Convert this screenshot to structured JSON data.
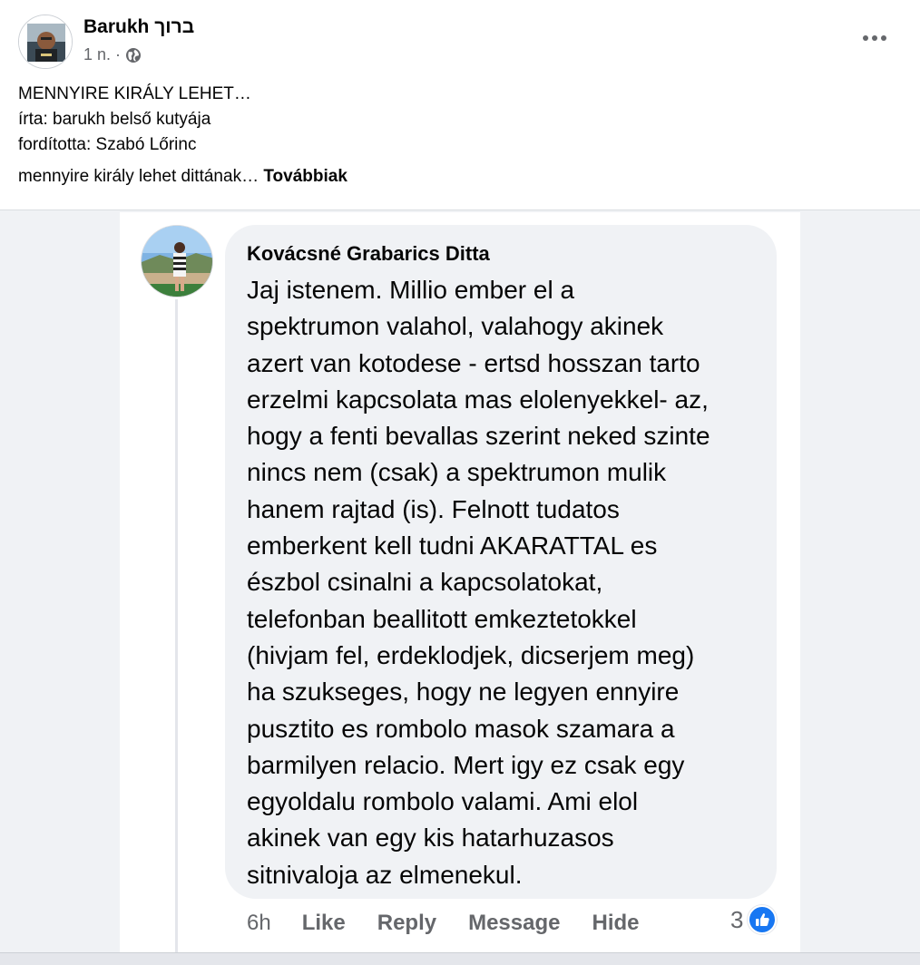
{
  "post": {
    "author": "Barukh ברוך",
    "time": "1 n.",
    "separator": "·",
    "text_lines": [
      "MENNYIRE KIRÁLY LEHET…",
      "írta: barukh belső kutyája",
      "fordította: Szabó Lőrinc"
    ],
    "preview": "mennyire király lehet dittának… ",
    "see_more": "Továbbiak"
  },
  "comment": {
    "author": "Kovácsné Grabarics Ditta",
    "lines": [
      "Jaj istenem. Millio ember el a",
      "spektrumon valahol, valahogy akinek",
      "azert van kotodese - ertsd hosszan tarto",
      "erzelmi kapcsolata mas elolenyekkel- az,",
      "hogy a fenti bevallas szerint neked szinte",
      "nincs nem (csak) a spektrumon mulik",
      "hanem rajtad (is). Felnott tudatos",
      "emberkent kell tudni AKARATTAL es",
      "észbol csinalni a kapcsolatokat,",
      "telefonban beallitott emkeztetokkel",
      "(hivjam fel, erdeklodjek, dicserjem meg)",
      "ha szukseges, hogy ne legyen ennyire",
      "pusztito es rombolo masok szamara a",
      "barmilyen relacio. Mert igy ez csak egy",
      "egyoldalu rombolo valami. Ami elol",
      "akinek van egy kis hatarhuzasos",
      "sitnivaloja az elmenekul."
    ],
    "time": "6h",
    "actions": {
      "like": "Like",
      "reply": "Reply",
      "message": "Message",
      "hide": "Hide"
    },
    "reaction_count": "3"
  },
  "colors": {
    "accent": "#1877f2",
    "muted_text": "#65676b",
    "bubble": "#f0f2f5"
  },
  "icons": {
    "privacy": "globe-icon",
    "more": "more-options-icon",
    "reaction": "like-thumb-icon"
  }
}
